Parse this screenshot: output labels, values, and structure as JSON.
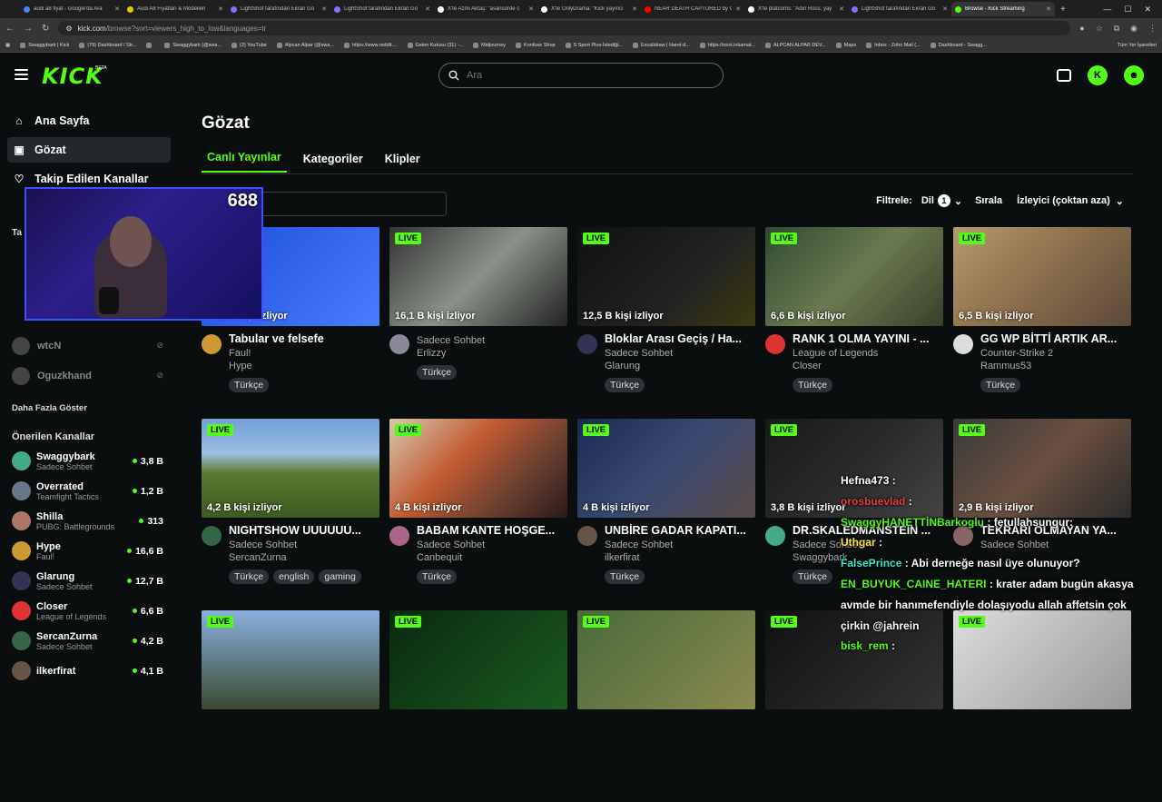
{
  "browser": {
    "tabs": [
      {
        "title": "audi a8 fiyat - Google'da Ara",
        "color": "#4285f4"
      },
      {
        "title": "Audi A8 Fiyatları & Modelleri",
        "color": "#e6c800"
      },
      {
        "title": "LightShot tarafından Ekran Gö",
        "color": "#8a6cff"
      },
      {
        "title": "LightShot tarafından Ekran Gö",
        "color": "#8a6cff"
      },
      {
        "title": "X'te Azmi Aktaş: \"asansörde c",
        "color": "#ffffff"
      },
      {
        "title": "X'te OnlyDrama: \"Kick yayıncı",
        "color": "#ffffff"
      },
      {
        "title": "NEAR DEATH CAPTURED by G",
        "color": "#ff0000"
      },
      {
        "title": "X'te platcoms: \"Adin Ross, yay",
        "color": "#ffffff"
      },
      {
        "title": "LightShot tarafından Ekran Gö",
        "color": "#8a6cff"
      },
      {
        "title": "Browse - Kick Streaming",
        "color": "#53fc18",
        "active": true
      }
    ],
    "url_host": "kick.com",
    "url_path": "/browse?sort=viewers_high_to_low&languages=tr",
    "bookmarks": [
      "Swaggybark | Kick",
      "(79) Dashboard / Str...",
      "",
      "Swaggybark (@swa...",
      "(2) YouTube",
      "Alpcan Alpar (@swa...",
      "https://www.reddit....",
      "Gelen Kutusu (31) -...",
      "Midjourney",
      "Konfuse Shop",
      "S Sport Plus-İstediği...",
      "Excalidraw | Hand-d...",
      "https://next.inkamat...",
      "ALPCAN ALPAR DEV...",
      "Maps",
      "Inbox - Zoho Mail (...",
      "Dashboard - Swagg..."
    ],
    "all_bookmarks": "Tüm Yer İşaretleri"
  },
  "header": {
    "logo": "KICK",
    "beta": "BETA",
    "search_placeholder": "Ara"
  },
  "sidebar": {
    "nav": [
      {
        "label": "Ana Sayfa",
        "icon": "home-icon"
      },
      {
        "label": "Gözat",
        "icon": "browse-icon",
        "active": true
      },
      {
        "label": "Takip Edilen Kanallar",
        "icon": "heart-icon"
      }
    ],
    "followed_title": "Ta",
    "followed": [
      {
        "name": "wtcN"
      },
      {
        "name": "Oguzkhand"
      }
    ],
    "show_more": "Daha Fazla Göster",
    "recommended_title": "Önerilen Kanallar",
    "recommended": [
      {
        "name": "Swaggybark",
        "category": "Sadece Sohbet",
        "viewers": "3,8 B",
        "color": "#4a8"
      },
      {
        "name": "Overrated",
        "category": "Teamfight Tactics",
        "viewers": "1,2 B",
        "color": "#678"
      },
      {
        "name": "Shilla",
        "category": "PUBG: Battlegrounds",
        "viewers": "313",
        "color": "#a76"
      },
      {
        "name": "Hype",
        "category": "Faul!",
        "viewers": "16,6 B",
        "color": "#c93"
      },
      {
        "name": "Glarung",
        "category": "Sadece Sohbet",
        "viewers": "12,7 B",
        "color": "#335"
      },
      {
        "name": "Closer",
        "category": "League of Legends",
        "viewers": "6,6 B",
        "color": "#d33"
      },
      {
        "name": "SercanZurna",
        "category": "Sadece Sohbet",
        "viewers": "4,2 B",
        "color": "#364"
      },
      {
        "name": "ilkerfirat",
        "category": "",
        "viewers": "4,1 B",
        "color": "#654"
      }
    ]
  },
  "main": {
    "title": "Gözat",
    "tabs": [
      "Canlı Yayınlar",
      "Kategoriler",
      "Klipler"
    ],
    "filter_label": "Filtrele:",
    "lang_label": "Dil",
    "lang_count": "1",
    "sort_label": "Sırala",
    "sort_value": "İzleyici (çoktan aza)",
    "live_label": "LIVE",
    "streams": [
      {
        "title": "Tabular ve felsefe",
        "category": "Faul!",
        "user": "Hype",
        "viewers": "16,6 B kişi izliyor",
        "tags": [
          "Türkçe"
        ],
        "bg": "linear-gradient(135deg,#1b4fd8,#4a7cff)",
        "av": "#c93"
      },
      {
        "title": "",
        "category": "Sadece Sohbet",
        "user": "Erlizzy",
        "viewers": "16,1 B kişi izliyor",
        "tags": [
          "Türkçe"
        ],
        "bg": "linear-gradient(135deg,#333,#8a9288 50%,#222)",
        "av": "#889"
      },
      {
        "title": "Bloklar Arası Geçiş / Ha...",
        "category": "Sadece Sohbet",
        "user": "Glarung",
        "viewers": "12,5 B kişi izliyor",
        "tags": [
          "Türkçe"
        ],
        "bg": "linear-gradient(135deg,#111,#222 60%,#3a3a10)",
        "av": "#335"
      },
      {
        "title": "RANK 1 OLMA YAYINI - ...",
        "category": "League of Legends",
        "user": "Closer",
        "viewers": "6,6 B kişi izliyor",
        "tags": [
          "Türkçe"
        ],
        "bg": "linear-gradient(135deg,#2f4a32,#6a7a50 50%,#3a3f2a)",
        "av": "#d33"
      },
      {
        "title": "GG WP BİTTİ ARTIK AR...",
        "category": "Counter-Strike 2",
        "user": "Rammus53",
        "viewers": "6,5 B kişi izliyor",
        "tags": [
          "Türkçe"
        ],
        "bg": "linear-gradient(135deg,#b89a70,#8a6e4a 50%,#5a4a3a)",
        "av": "#ddd"
      },
      {
        "title": "NIGHTSHOW UUUUUU...",
        "category": "Sadece Sohbet",
        "user": "SercanZurna",
        "viewers": "4,2 B kişi izliyor",
        "tags": [
          "Türkçe",
          "english",
          "gaming"
        ],
        "bg": "linear-gradient(180deg,#6fa0d8 0%,#9cc0e0 35%,#5a7a30 55%,#3d5a20 100%)",
        "av": "#364"
      },
      {
        "title": "BABAM KANTE HOŞGE...",
        "category": "Sadece Sohbet",
        "user": "Canbequit",
        "viewers": "4 B kişi izliyor",
        "tags": [
          "Türkçe"
        ],
        "bg": "linear-gradient(135deg,#d8c8b0,#c05a30 40%,#6a4030 70%,#2a1a1a)",
        "av": "#a68"
      },
      {
        "title": "UNBİRE GADAR KAPATI...",
        "category": "Sadece Sohbet",
        "user": "ilkerfirat",
        "viewers": "4 B kişi izliyor",
        "tags": [
          "Türkçe"
        ],
        "bg": "linear-gradient(135deg,#1a2a50,#3a4a70 50%,#5a4a48)",
        "av": "#654"
      },
      {
        "title": "DR.SKALEDMANSTEIN ...",
        "category": "Sadece Sohbet",
        "user": "Swaggybark",
        "viewers": "3,8 B kişi izliyor",
        "tags": [
          "Türkçe"
        ],
        "bg": "linear-gradient(135deg,#1a1a1a,#2a2a2a 50%,#444)",
        "av": "#4a8"
      },
      {
        "title": "TEKRARI OLMAYAN YA...",
        "category": "Sadece Sohbet",
        "user": "",
        "viewers": "2,9 B kişi izliyor",
        "tags": [],
        "bg": "linear-gradient(135deg,#3a3a3a,#6a5040 50%,#2a2a2a)",
        "av": "#866"
      },
      {
        "title": "",
        "category": "",
        "user": "",
        "viewers": "",
        "tags": [],
        "bg": "linear-gradient(180deg,#8ab0e0,#3a4a30)",
        "av": "#444"
      },
      {
        "title": "",
        "category": "",
        "user": "",
        "viewers": "",
        "tags": [],
        "bg": "linear-gradient(135deg,#0a2a10,#1a5a20)",
        "av": "#444"
      },
      {
        "title": "",
        "category": "",
        "user": "",
        "viewers": "",
        "tags": [],
        "bg": "linear-gradient(135deg,#4a6a3a,#8a8a50)",
        "av": "#444"
      },
      {
        "title": "",
        "category": "",
        "user": "",
        "viewers": "",
        "tags": [],
        "bg": "linear-gradient(135deg,#111,#333)",
        "av": "#444"
      },
      {
        "title": "",
        "category": "",
        "user": "",
        "viewers": "",
        "tags": [],
        "bg": "linear-gradient(135deg,#ddd,#999)",
        "av": "#444"
      }
    ]
  },
  "overlay": {
    "webcam_count": "688",
    "chat": [
      {
        "user": "Hefna473",
        "sep": " :",
        "msg": "",
        "cls": "cn"
      },
      {
        "user": "orosbuevlad",
        "sep": " :",
        "msg": "",
        "cls": "cn-r"
      },
      {
        "user": "SwaggyHANETTİNBarkoglu",
        "sep": " :",
        "msg": "  fetullahsungur:",
        "cls": "cn-g"
      },
      {
        "user": "Uthgar",
        "sep": " :",
        "msg": "",
        "cls": "cn-y"
      },
      {
        "user": "FalsePrince",
        "sep": " :",
        "msg": " Abi derneğe nasıl üye olunuyor?",
        "cls": "cn-c"
      },
      {
        "user": "EN_BUYUK_CAINE_HATERI",
        "sep": " :",
        "msg": " krater adam bugün akasya",
        "cls": "cn-g"
      },
      {
        "user": "",
        "sep": "",
        "msg": "avmde bir hanımefendiyle dolaşıyodu allah affetsin çok",
        "cls": "cn"
      },
      {
        "user": "",
        "sep": "",
        "msg": "çirkin @jahrein",
        "cls": "cn"
      },
      {
        "user": "bisk_rem",
        "sep": " :",
        "msg": "",
        "cls": "cn-g"
      }
    ]
  }
}
